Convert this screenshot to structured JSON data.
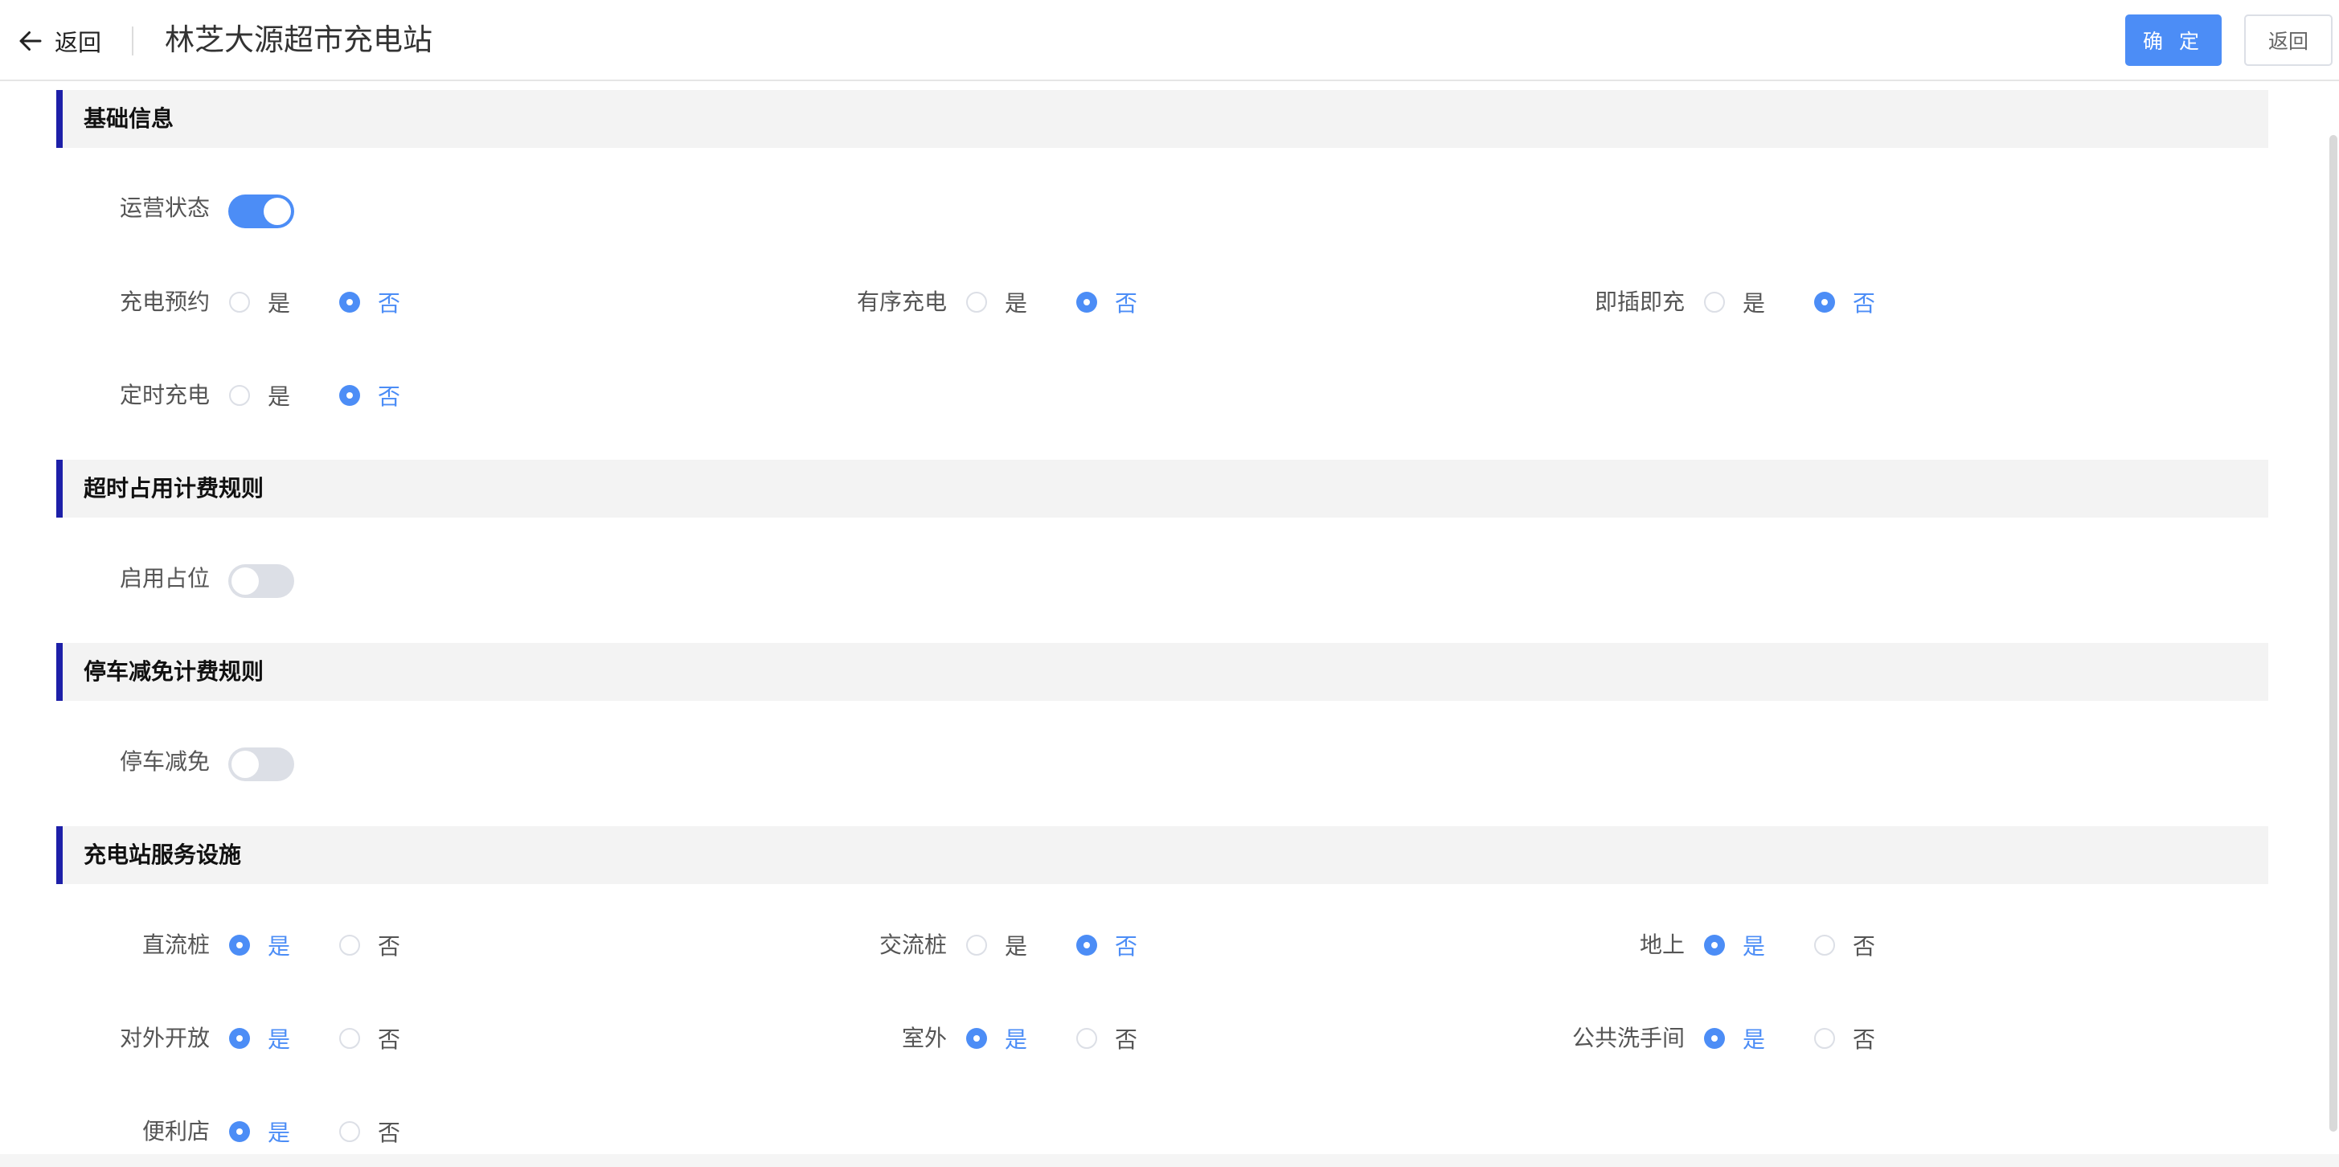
{
  "header": {
    "back_label": "返回",
    "title": "林芝大源超市充电站",
    "confirm_label": "确 定",
    "return_label": "返回"
  },
  "sections": {
    "basic": {
      "title": "基础信息",
      "operation_status": {
        "label": "运营状态",
        "on": true
      },
      "reservation": {
        "label": "充电预约",
        "yes": "是",
        "no": "否",
        "value": "否"
      },
      "ordered": {
        "label": "有序充电",
        "yes": "是",
        "no": "否",
        "value": "否"
      },
      "plug_charge": {
        "label": "即插即充",
        "yes": "是",
        "no": "否",
        "value": "否"
      },
      "timed": {
        "label": "定时充电",
        "yes": "是",
        "no": "否",
        "value": "否"
      }
    },
    "overtime": {
      "title": "超时占用计费规则",
      "enable_occupy": {
        "label": "启用占位",
        "on": false
      }
    },
    "parking": {
      "title": "停车减免计费规则",
      "parking_waiver": {
        "label": "停车减免",
        "on": false
      }
    },
    "facilities": {
      "title": "充电站服务设施",
      "dc_pile": {
        "label": "直流桩",
        "yes": "是",
        "no": "否",
        "value": "是"
      },
      "ac_pile": {
        "label": "交流桩",
        "yes": "是",
        "no": "否",
        "value": "否"
      },
      "ground": {
        "label": "地上",
        "yes": "是",
        "no": "否",
        "value": "是"
      },
      "open_public": {
        "label": "对外开放",
        "yes": "是",
        "no": "否",
        "value": "是"
      },
      "outdoor": {
        "label": "室外",
        "yes": "是",
        "no": "否",
        "value": "是"
      },
      "restroom": {
        "label": "公共洗手间",
        "yes": "是",
        "no": "否",
        "value": "是"
      },
      "store": {
        "label": "便利店",
        "yes": "是",
        "no": "否",
        "value": "是"
      }
    }
  },
  "colors": {
    "primary": "#4c8df6",
    "section_accent": "#1d1fa8",
    "section_bg": "#f3f3f3"
  }
}
